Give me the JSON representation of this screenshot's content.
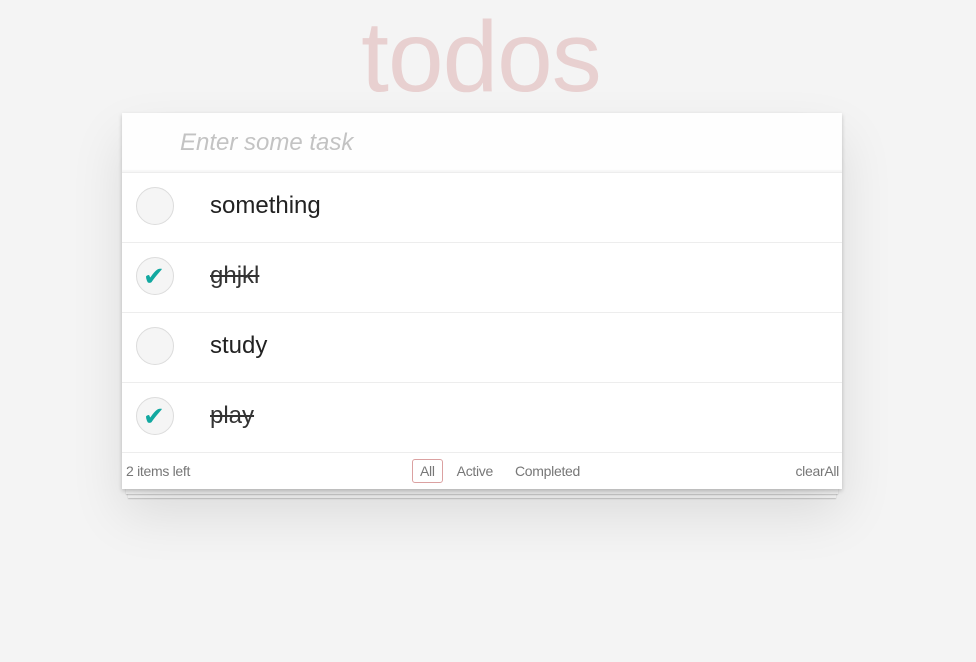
{
  "header": {
    "title": "todos"
  },
  "new_todo": {
    "placeholder": "Enter some task",
    "value": ""
  },
  "todos": [
    {
      "label": "something",
      "completed": false
    },
    {
      "label": "ghjkl",
      "completed": true
    },
    {
      "label": "study",
      "completed": false
    },
    {
      "label": "play",
      "completed": true
    }
  ],
  "footer": {
    "count_text": "2 items left",
    "filters": [
      {
        "label": "All",
        "selected": true
      },
      {
        "label": "Active",
        "selected": false
      },
      {
        "label": "Completed",
        "selected": false
      }
    ],
    "clear_label": "clearAll"
  },
  "colors": {
    "title": "#eed5d5",
    "check": "#12a8a0",
    "selected_filter_border": "#d7a3a3"
  },
  "icons": {
    "check": "check-mark-icon"
  }
}
